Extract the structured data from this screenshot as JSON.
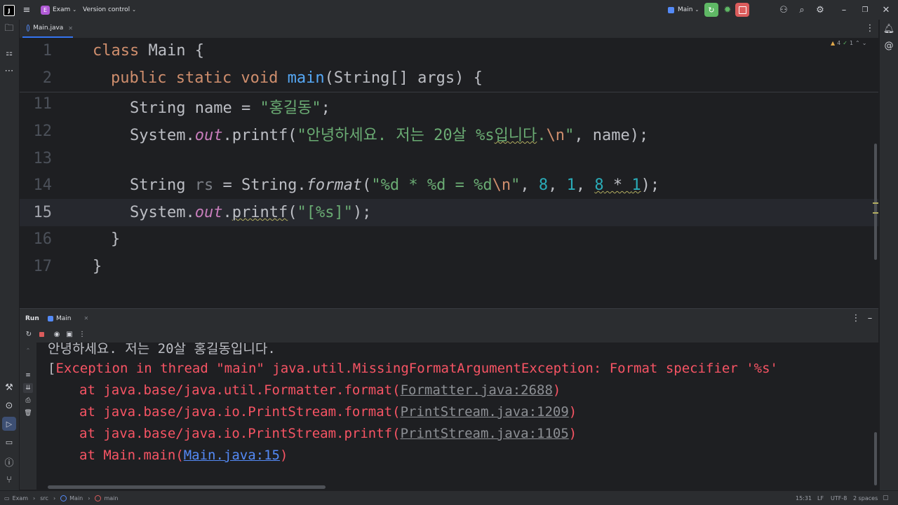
{
  "titlebar": {
    "project_badge": "E",
    "project_name": "Exam",
    "vcs_label": "Version control",
    "run_config": "Main"
  },
  "editor": {
    "tab_label": "Main.java",
    "inspection": {
      "warnings": "4",
      "checks": "1"
    },
    "line_numbers": [
      "1",
      "2",
      "11",
      "12",
      "13",
      "14",
      "15",
      "16",
      "17"
    ],
    "code": {
      "l1_kw": "class",
      "l1_rest": " Main {",
      "l2_kw": "public static void",
      "l2_fn": "main",
      "l2_rest": "(String[] args) {",
      "l11_a": "String name = ",
      "l11_str": "\"홍길동\"",
      "l11_end": ";",
      "l12_a": "System.",
      "l12_out": "out",
      "l12_b": ".printf(",
      "l12_str1": "\"안녕하세요. 저는 20살 %s",
      "l12_warn": "입니다",
      "l12_str2": ".",
      "l12_esc": "\\n",
      "l12_str3": "\"",
      "l12_end": ", name);",
      "l14_a": "String ",
      "l14_rs": "rs",
      "l14_b": " = String.",
      "l14_fmt": "format",
      "l14_c": "(",
      "l14_str1": "\"%d * %d = %d",
      "l14_esc": "\\n",
      "l14_str2": "\"",
      "l14_d": ", ",
      "l14_n1": "8",
      "l14_e": ", ",
      "l14_n2": "1",
      "l14_f": ", ",
      "l14_n3": "8",
      "l14_g": " * ",
      "l14_n4": "1",
      "l14_end": ");",
      "l15_a": "System.",
      "l15_out": "out",
      "l15_b": ".",
      "l15_printf": "printf",
      "l15_c": "(",
      "l15_str": "\"[%s]\"",
      "l15_end": ");",
      "l16": "}",
      "l17": "}"
    }
  },
  "run": {
    "run_label": "Run",
    "tab_label": "Main",
    "console": {
      "line0": "안녕하세요. 저는 20살 홍길동입니다.",
      "line1_bracket": "[",
      "line1": "Exception in thread \"main\" java.util.MissingFormatArgumentException: Format specifier '%s'",
      "line2_a": "at java.base/java.util.Formatter.format(",
      "line2_link": "Formatter.java:2688",
      "line2_b": ")",
      "line3_a": "at java.base/java.io.PrintStream.format(",
      "line3_link": "PrintStream.java:1209",
      "line3_b": ")",
      "line4_a": "at java.base/java.io.PrintStream.printf(",
      "line4_link": "PrintStream.java:1105",
      "line4_b": ")",
      "line5_a": "at Main.main(",
      "line5_link": "Main.java:15",
      "line5_b": ")"
    }
  },
  "statusbar": {
    "crumb1": "Exam",
    "crumb2": "src",
    "crumb3": "Main",
    "crumb4": "main",
    "position": "15:31",
    "line_sep": "LF",
    "encoding": "UTF-8",
    "indent": "2 spaces"
  },
  "colors": {
    "accent": "#3574f0",
    "keyword": "#cf8e6d",
    "string": "#6aab73",
    "number": "#2aacb8",
    "error": "#f75464",
    "run_green": "#5fb865",
    "stop_red": "#db5c5c"
  },
  "icons": [
    "app-logo-icon",
    "hamburger-menu-icon",
    "chevron-down-icon",
    "run-icon",
    "debug-icon",
    "stop-icon",
    "add-user-icon",
    "search-icon",
    "settings-icon",
    "minimize-icon",
    "maximize-icon",
    "close-icon",
    "folder-icon",
    "structure-icon",
    "more-icon",
    "notifications-icon",
    "ai-assistant-icon",
    "rerun-icon",
    "camera-icon",
    "scroll-icon",
    "print-icon",
    "trash-icon",
    "build-icon",
    "services-icon",
    "terminal-icon",
    "problems-icon",
    "git-icon"
  ]
}
